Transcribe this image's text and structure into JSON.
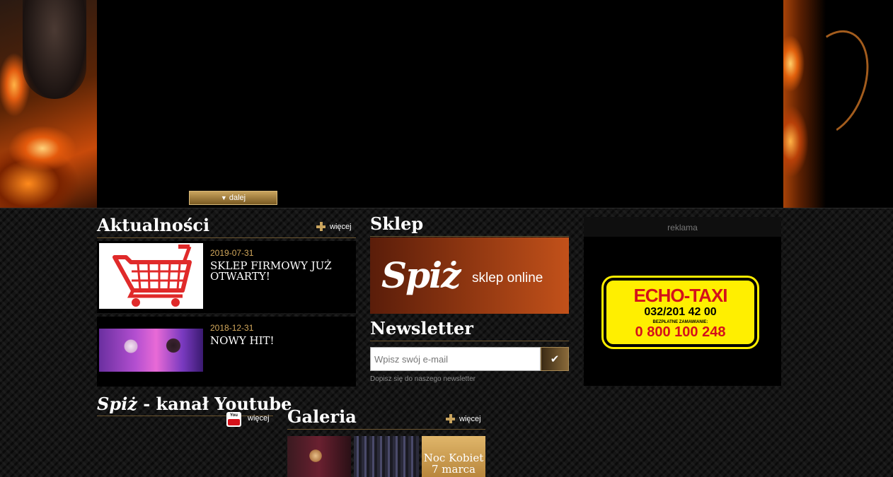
{
  "hero": {
    "more_label": "dalej"
  },
  "news": {
    "title": "Aktualności",
    "more_label": "więcej",
    "items": [
      {
        "date": "2019-07-31",
        "title": "SKLEP FIRMOWY JUŻ OTWARTY!",
        "image": "shopping-cart"
      },
      {
        "date": "2018-12-31",
        "title": "NOWY HIT!",
        "image": "artists-photo"
      }
    ]
  },
  "shop": {
    "title": "Sklep",
    "banner_logo": "Spiż",
    "banner_text": "sklep online"
  },
  "newsletter": {
    "title": "Newsletter",
    "placeholder": "Wpisz swój e-mail",
    "note": "Dopisz się do naszego newsletter",
    "submit_icon": "check-icon"
  },
  "ad": {
    "label": "reklama",
    "taxi_name": "ECHO-TAXI",
    "phone": "032/201 42 00",
    "free_label": "BEZPŁATNE ZAMAWIANIE:",
    "free_number": "0 800 100 248"
  },
  "youtube": {
    "logo": "Spiż",
    "title": "- kanał Youtube",
    "more_label": "więcej",
    "icon_text": "You"
  },
  "gallery": {
    "title": "Galeria",
    "more_label": "więcej",
    "caption_line1": "Noc Kobiet",
    "caption_line2": "7 marca"
  },
  "colors": {
    "gold": "#c9a45e",
    "date_gold": "#d4a95c",
    "background": "#000000"
  }
}
